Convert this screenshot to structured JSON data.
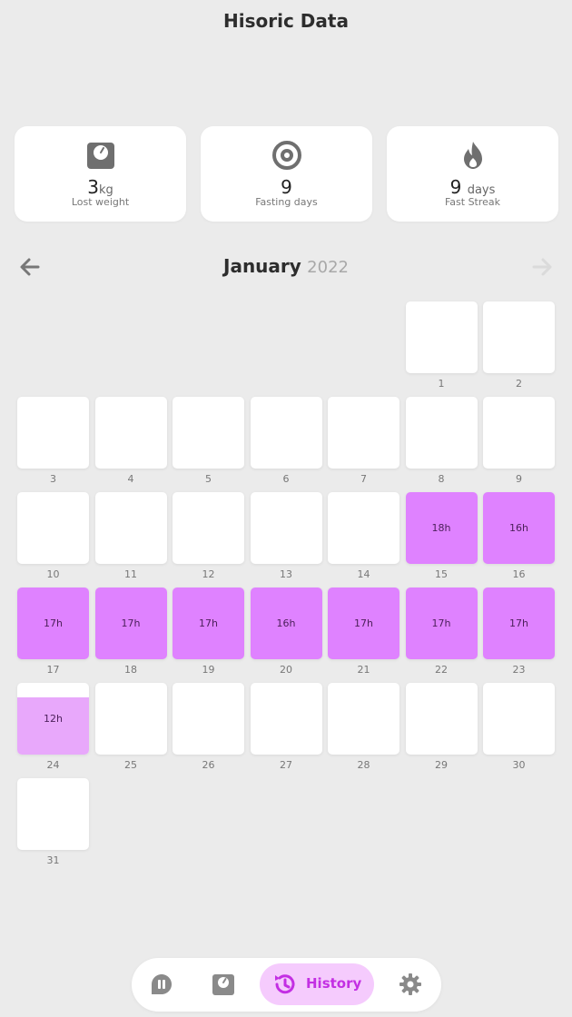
{
  "header": {
    "title": "Hisoric Data"
  },
  "stats": [
    {
      "icon": "scale-icon",
      "value": "3",
      "unit": "kg",
      "label": "Lost weight"
    },
    {
      "icon": "target-icon",
      "value": "9",
      "unit": "",
      "label": "Fasting days"
    },
    {
      "icon": "flame-icon",
      "value": "9",
      "unit": "days",
      "label": "Fast Streak"
    }
  ],
  "month_nav": {
    "month": "January",
    "year": "2022"
  },
  "calendar": {
    "first_weekday_index": 5,
    "fast_color": "#df82ff",
    "partial_color": "#e8a8fb",
    "days": [
      {
        "day": "1",
        "hours": ""
      },
      {
        "day": "2",
        "hours": ""
      },
      {
        "day": "3",
        "hours": ""
      },
      {
        "day": "4",
        "hours": ""
      },
      {
        "day": "5",
        "hours": ""
      },
      {
        "day": "6",
        "hours": ""
      },
      {
        "day": "7",
        "hours": ""
      },
      {
        "day": "8",
        "hours": ""
      },
      {
        "day": "9",
        "hours": ""
      },
      {
        "day": "10",
        "hours": ""
      },
      {
        "day": "11",
        "hours": ""
      },
      {
        "day": "12",
        "hours": ""
      },
      {
        "day": "13",
        "hours": ""
      },
      {
        "day": "14",
        "hours": ""
      },
      {
        "day": "15",
        "hours": "18h",
        "fill": 1
      },
      {
        "day": "16",
        "hours": "16h",
        "fill": 1
      },
      {
        "day": "17",
        "hours": "17h",
        "fill": 1
      },
      {
        "day": "18",
        "hours": "17h",
        "fill": 1
      },
      {
        "day": "19",
        "hours": "17h",
        "fill": 1
      },
      {
        "day": "20",
        "hours": "16h",
        "fill": 1
      },
      {
        "day": "21",
        "hours": "17h",
        "fill": 1
      },
      {
        "day": "22",
        "hours": "17h",
        "fill": 1
      },
      {
        "day": "23",
        "hours": "17h",
        "fill": 1
      },
      {
        "day": "24",
        "hours": "12h",
        "fill": 0.8
      },
      {
        "day": "25",
        "hours": ""
      },
      {
        "day": "26",
        "hours": ""
      },
      {
        "day": "27",
        "hours": ""
      },
      {
        "day": "28",
        "hours": ""
      },
      {
        "day": "29",
        "hours": ""
      },
      {
        "day": "30",
        "hours": ""
      },
      {
        "day": "31",
        "hours": ""
      }
    ]
  },
  "bottom_nav": {
    "active_label": "History",
    "accent": "#c32fe3"
  }
}
